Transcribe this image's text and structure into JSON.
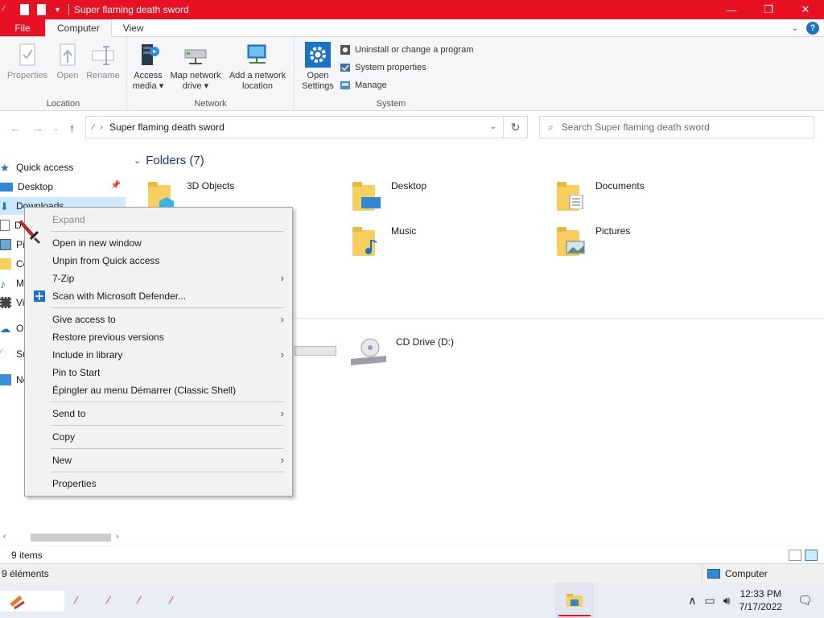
{
  "window": {
    "title": "Super flaming death sword",
    "minimize_glyph": "—",
    "restore_glyph": "❐",
    "close_glyph": "✕"
  },
  "ribbon_tabs": {
    "file": "File",
    "computer": "Computer",
    "view": "View"
  },
  "ribbon": {
    "location": {
      "label": "Location",
      "properties": "Properties",
      "open": "Open",
      "rename": "Rename"
    },
    "network": {
      "label": "Network",
      "access_media_1": "Access",
      "access_media_2": "media ▾",
      "map_drive_1": "Map network",
      "map_drive_2": "drive ▾",
      "add_location_1": "Add a network",
      "add_location_2": "location"
    },
    "system": {
      "label": "System",
      "open_settings_1": "Open",
      "open_settings_2": "Settings",
      "uninstall": "Uninstall or change a program",
      "system_properties": "System properties",
      "manage": "Manage"
    }
  },
  "address": {
    "path": "Super flaming death sword",
    "search_placeholder": "Search Super flaming death sword"
  },
  "nav_pane": {
    "items": [
      {
        "label": "Quick access"
      },
      {
        "label": "Desktop"
      },
      {
        "label": "Downloads"
      },
      {
        "label": "D"
      },
      {
        "label": "Pi"
      },
      {
        "label": "Cc"
      },
      {
        "label": "M"
      },
      {
        "label": "Vi"
      },
      {
        "label": "One"
      },
      {
        "label": "Sup"
      },
      {
        "label": "Net"
      }
    ]
  },
  "content": {
    "folders_header": "Folders (7)",
    "folders": [
      {
        "name": "3D Objects"
      },
      {
        "name": "Desktop"
      },
      {
        "name": "Documents"
      },
      {
        "name": "Music"
      },
      {
        "name": "Pictures"
      }
    ],
    "drives": [
      {
        "name": "CD Drive (D:)"
      }
    ]
  },
  "context_menu": {
    "expand": "Expand",
    "open_new_window": "Open in new window",
    "unpin": "Unpin from Quick access",
    "seven_zip": "7-Zip",
    "defender": "Scan with Microsoft Defender...",
    "give_access": "Give access to",
    "restore_versions": "Restore previous versions",
    "include_library": "Include in library",
    "pin_start": "Pin to Start",
    "pin_classic": "Épingler au menu Démarrer (Classic Shell)",
    "send_to": "Send to",
    "copy": "Copy",
    "new": "New",
    "properties": "Properties"
  },
  "status": {
    "items_count": "9 items",
    "elements_count": "9 éléments",
    "computer": "Computer"
  },
  "taskbar": {
    "time": "12:33 PM",
    "date": "7/17/2022"
  },
  "colors": {
    "accent": "#e81123",
    "selection": "#cce8ff",
    "folder": "#f6cf5c"
  }
}
